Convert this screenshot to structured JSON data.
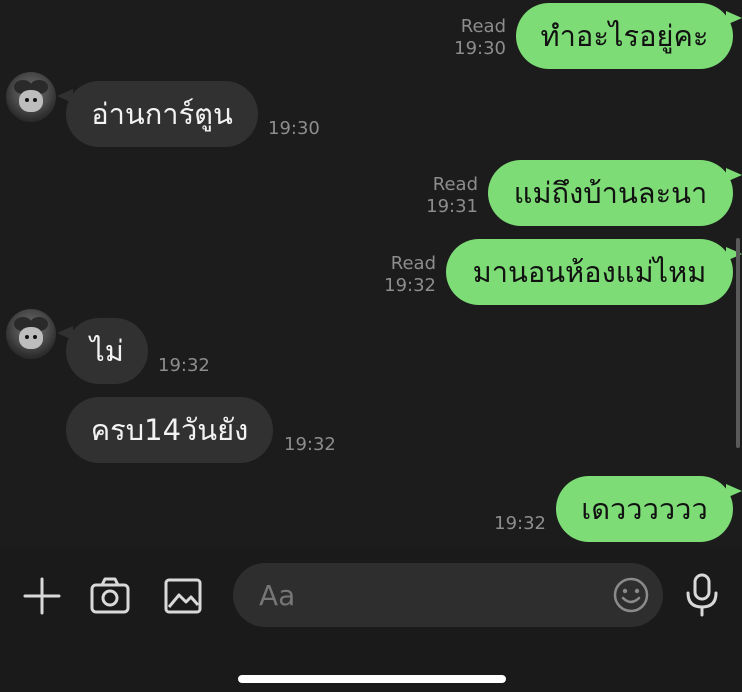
{
  "messages": [
    {
      "side": "out",
      "text": "ทำอะไรอยู่คะ",
      "read": "Read",
      "time": "19:30"
    },
    {
      "side": "in",
      "text": "อ่านการ์ตูน",
      "time": "19:30"
    },
    {
      "side": "out",
      "text": "แม่ถึงบ้านละนา",
      "read": "Read",
      "time": "19:31"
    },
    {
      "side": "out",
      "text": "มานอนห้องแม่ไหม",
      "read": "Read",
      "time": "19:32"
    },
    {
      "side": "in",
      "text": "ไม่",
      "time": "19:32"
    },
    {
      "side": "in",
      "text": "ครบ14วันยัง",
      "time": "19:32"
    },
    {
      "side": "out",
      "text": "เดวววววว",
      "time": "19:32"
    }
  ],
  "composer": {
    "placeholder": "Aa"
  },
  "icons": {
    "plus": "plus-icon",
    "camera": "camera-icon",
    "image": "image-icon",
    "emoji": "emoji-icon",
    "mic": "microphone-icon"
  },
  "colors": {
    "background": "#1c1c1c",
    "outgoing_bubble": "#7ddc76",
    "incoming_bubble": "#313131",
    "meta_text": "#8d8d8d"
  }
}
